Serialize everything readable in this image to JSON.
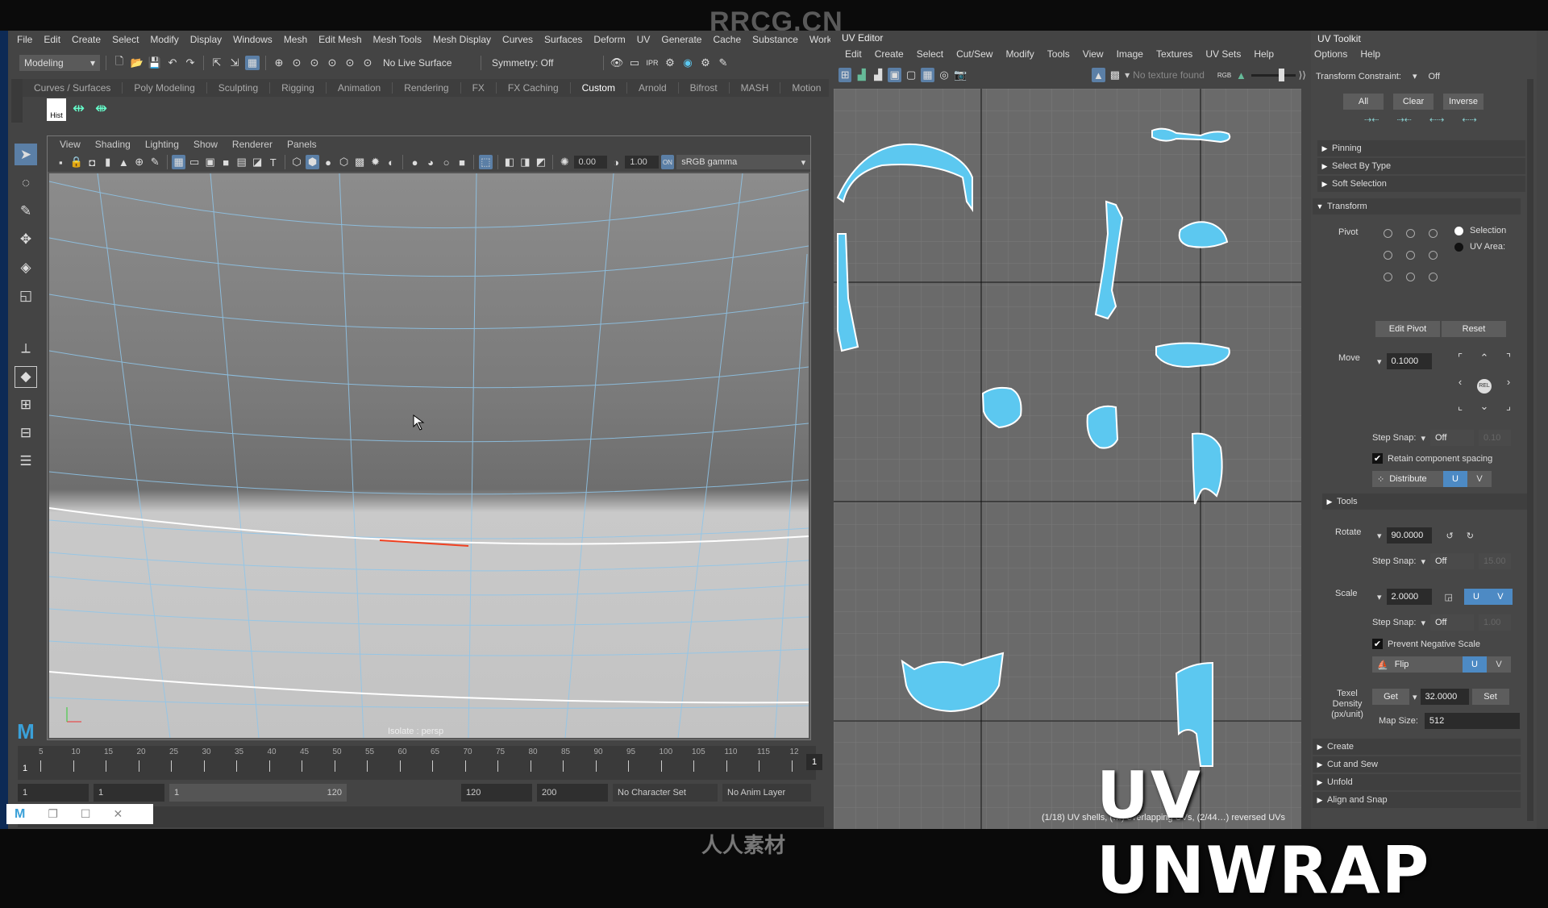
{
  "watermark_top": "RRCG.CN",
  "main_menu": [
    "File",
    "Edit",
    "Create",
    "Select",
    "Modify",
    "Display",
    "Windows",
    "Mesh",
    "Edit Mesh",
    "Mesh Tools",
    "Mesh Display",
    "Curves",
    "Surfaces",
    "Deform",
    "UV",
    "Generate",
    "Cache",
    "Substance",
    "Works"
  ],
  "status_line": {
    "menu_set": "Modeling",
    "live_surface": "No Live Surface",
    "symmetry": "Symmetry: Off"
  },
  "shelf_tabs": [
    "Curves / Surfaces",
    "Poly Modeling",
    "Sculpting",
    "Rigging",
    "Animation",
    "Rendering",
    "FX",
    "FX Caching",
    "Custom",
    "Arnold",
    "Bifrost",
    "MASH",
    "Motion"
  ],
  "shelf_active_tab": "Custom",
  "shelf": {
    "hist_label": "Hist"
  },
  "viewport": {
    "menu": [
      "View",
      "Shading",
      "Lighting",
      "Show",
      "Renderer",
      "Panels"
    ],
    "exposure": "0.00",
    "gamma": "1.00",
    "color_space": "sRGB gamma",
    "label": "Isolate : persp"
  },
  "timeline": {
    "ticks": [
      "5",
      "10",
      "15",
      "20",
      "25",
      "30",
      "35",
      "40",
      "45",
      "50",
      "55",
      "60",
      "65",
      "70",
      "75",
      "80",
      "85",
      "90",
      "95",
      "100",
      "105",
      "110",
      "115",
      "12"
    ],
    "current_frame": "1",
    "right_frame": "1"
  },
  "range": {
    "start": "1",
    "playback_start": "1",
    "slider_start": "1",
    "slider_end": "120",
    "playback_end": "120",
    "end": "200",
    "character_set": "No Character Set",
    "anim_layer": "No Anim Layer"
  },
  "uv_editor": {
    "title": "UV Editor",
    "menu": [
      "Edit",
      "Create",
      "Select",
      "Cut/Sew",
      "Modify",
      "Tools",
      "View",
      "Image",
      "Textures",
      "UV Sets",
      "Help"
    ],
    "texture_status": "No texture found",
    "status": "(1/18) UV shells, (…) overlapping UVs, (2/44…) reversed UVs"
  },
  "uv_toolkit": {
    "title": "UV Toolkit",
    "menu": [
      "Options",
      "Help"
    ],
    "transform_constraint_label": "Transform Constraint:",
    "transform_constraint_value": "Off",
    "select_buttons": [
      "All",
      "Clear",
      "Inverse"
    ],
    "collapsed_sections_top": [
      "Pinning",
      "Select By Type",
      "Soft Selection"
    ],
    "transform_section": "Transform",
    "pivot_label": "Pivot",
    "pivot_options": [
      "Selection",
      "UV Area:"
    ],
    "pivot_buttons": [
      "Edit Pivot",
      "Reset"
    ],
    "move_label": "Move",
    "move_value": "0.1000",
    "rel_label": "REL",
    "step_snap_label": "Step Snap:",
    "move_step_snap": "Off",
    "move_step_value": "0.10",
    "retain_spacing": "Retain component spacing",
    "distribute": "Distribute",
    "u": "U",
    "v": "V",
    "tools_section": "Tools",
    "rotate_label": "Rotate",
    "rotate_value": "90.0000",
    "rotate_step_snap": "Off",
    "rotate_step_value": "15.00",
    "scale_label": "Scale",
    "scale_value": "2.0000",
    "scale_step_snap": "Off",
    "scale_step_value": "1.00",
    "prevent_negative": "Prevent Negative Scale",
    "flip": "Flip",
    "texel_density_label": "Texel Density (px/unit)",
    "get": "Get",
    "texel_value": "32.0000",
    "set": "Set",
    "map_size_label": "Map Size:",
    "map_size": "512",
    "collapsed_sections_bottom": [
      "Create",
      "Cut and Sew",
      "Unfold",
      "Align and Snap"
    ]
  },
  "overlay_title": "UV UNWRAP",
  "bottom_logo": "人人素材",
  "colors": {
    "accent": "#4d8ac4",
    "uv_shell": "#5cc8f0",
    "panel": "#444444"
  }
}
